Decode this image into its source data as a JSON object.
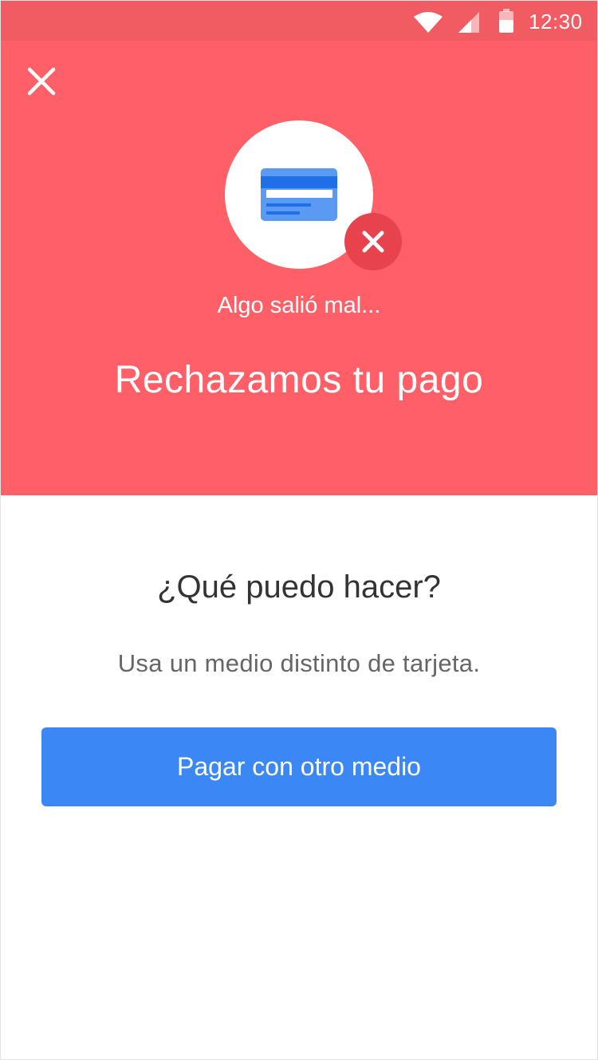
{
  "status_bar": {
    "time": "12:30",
    "wifi_icon": "wifi-icon",
    "signal_icon": "cell-signal-icon",
    "battery_icon": "battery-icon"
  },
  "header": {
    "close_icon": "close-icon",
    "hero_icon": "credit-card-icon",
    "badge_icon": "error-x-icon",
    "subtitle": "Algo salió mal...",
    "title": "Rechazamos tu pago"
  },
  "body": {
    "question": "¿Qué puedo hacer?",
    "hint": "Usa un medio distinto de tarjeta.",
    "primary_button_label": "Pagar con otro medio"
  },
  "colors": {
    "header_background": "#ff5f67",
    "status_bar_background": "#f15b62",
    "error_badge": "#e8424d",
    "primary_button": "#3b88f5",
    "card_blue": "#5b9af2"
  }
}
